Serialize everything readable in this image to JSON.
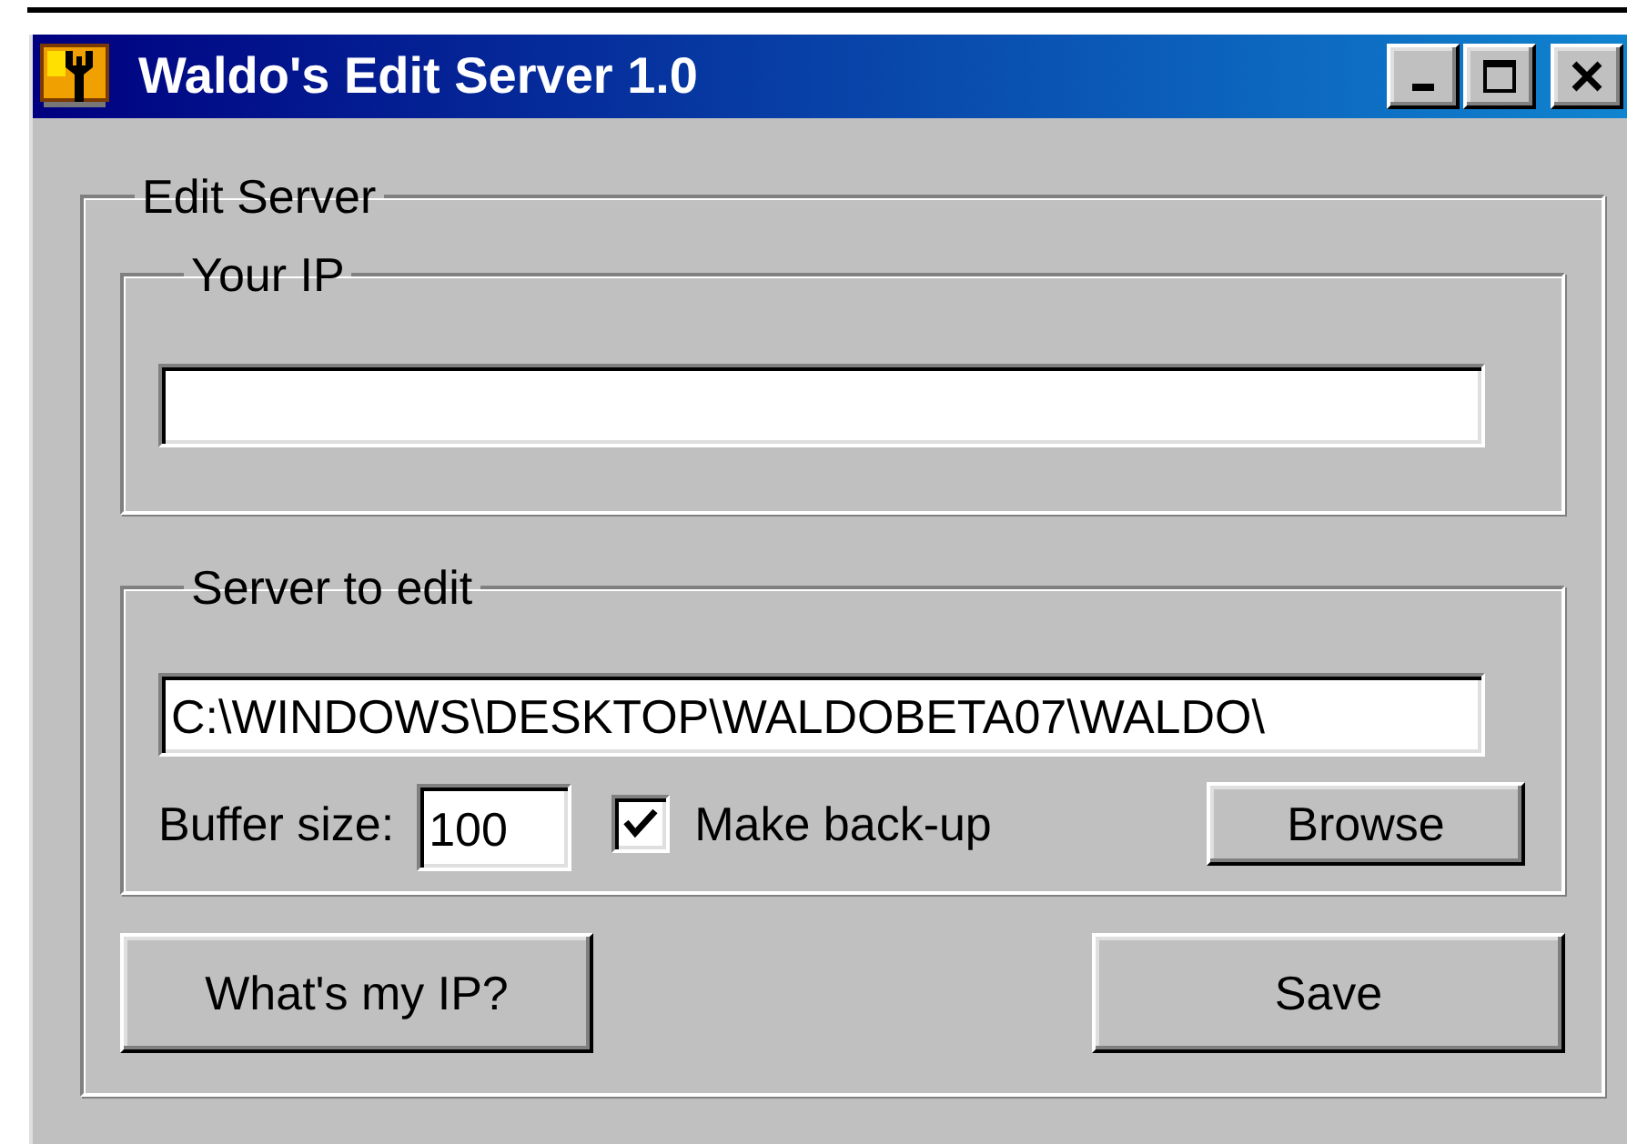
{
  "window": {
    "title": "Waldo's Edit Server 1.0"
  },
  "group": {
    "title": "Edit Server"
  },
  "your_ip": {
    "title": "Your IP"
  },
  "server": {
    "title": "Server to edit",
    "path": "C:\\WINDOWS\\DESKTOP\\WALDOBETA07\\WALDO\\",
    "buffer_label": "Buffer size:",
    "buffer_value": "100",
    "backup": {
      "label": "Make back-up",
      "checked": true
    },
    "browse": "Browse"
  },
  "buttons": [
    "What's my IP?",
    "Save"
  ]
}
